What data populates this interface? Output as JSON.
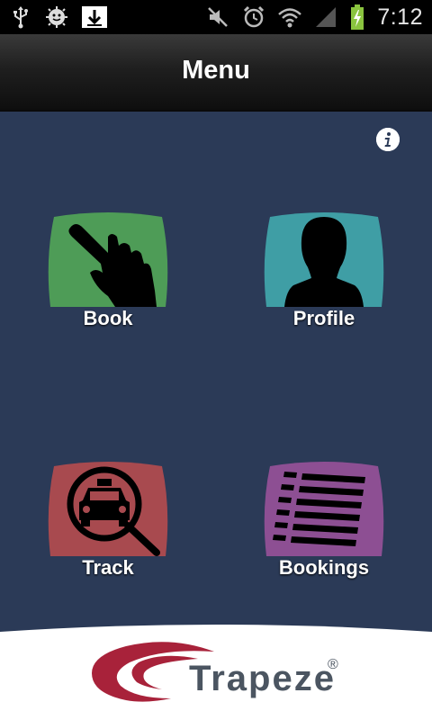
{
  "status_bar": {
    "left_icons": [
      "usb-icon",
      "android-debug-icon",
      "download-icon"
    ],
    "right_icons": [
      "mute-icon",
      "alarm-icon",
      "wifi-icon",
      "signal-icon",
      "battery-charging-icon"
    ],
    "time": "7:12"
  },
  "header": {
    "title": "Menu"
  },
  "info_button": {
    "icon": "info-icon"
  },
  "tiles": [
    {
      "label": "Book",
      "icon": "pointing-hand-icon",
      "color": "#4e9c57"
    },
    {
      "label": "Profile",
      "icon": "person-silhouette-icon",
      "color": "#3f9ea5"
    },
    {
      "label": "Track",
      "icon": "taxi-magnifier-icon",
      "color": "#a84a4f"
    },
    {
      "label": "Bookings",
      "icon": "list-icon",
      "color": "#8d4f93"
    }
  ],
  "footer": {
    "brand": "Trapeze",
    "registered_mark": "®",
    "brand_accent_color": "#a8223a"
  },
  "colors": {
    "background": "#2b3a57",
    "titlebar": "#111111",
    "text": "#ffffff"
  }
}
